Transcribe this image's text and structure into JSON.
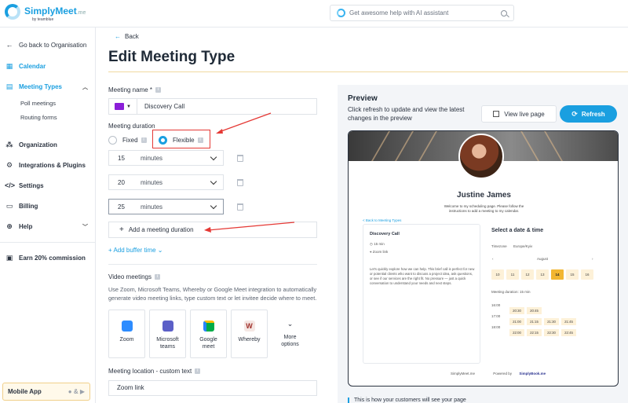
{
  "brand": {
    "name": "SimplyMeet",
    "suffix": ".me",
    "by": "by teamblue"
  },
  "search": {
    "placeholder": "Get awesome help with AI assistant"
  },
  "sidebar": {
    "back": "Go back to Organisation",
    "calendar": "Calendar",
    "meeting_types": "Meeting Types",
    "sub_items": [
      "Poll meetings",
      "Routing forms"
    ],
    "organization": "Organization",
    "integrations": "Integrations & Plugins",
    "settings": "Settings",
    "billing": "Billing",
    "help": "Help",
    "earn": "Earn 20% commission",
    "mobile_app": "Mobile App",
    "mobile_sep": "&"
  },
  "main": {
    "back": "Back",
    "title": "Edit Meeting Type",
    "meeting_name_label": "Meeting name *",
    "meeting_name_value": "Discovery Call",
    "meeting_color": "#8b1ed8",
    "duration_label": "Meeting duration",
    "option_fixed": "Fixed",
    "option_flexible": "Flexible",
    "selected_option": "Flexible",
    "durations": [
      {
        "value": "15",
        "unit": "minutes"
      },
      {
        "value": "20",
        "unit": "minutes"
      },
      {
        "value": "25",
        "unit": "minutes"
      }
    ],
    "add_duration": "Add a meeting duration",
    "add_buffer": "Add buffer time",
    "video_label": "Video meetings",
    "video_desc": "Use Zoom, Microsoft Teams, Whereby or Google Meet integration to automatically generate video meeting links, type custom text or let invitee decide where to meet.",
    "video_options": [
      {
        "label": "Zoom",
        "icon": "zoom-icon",
        "color": "#2d8cff"
      },
      {
        "label": "Microsoft teams",
        "icon": "teams-icon",
        "color": "#5b5fc7"
      },
      {
        "label": "Google meet",
        "icon": "google-meet-icon",
        "color": "#00ac47"
      },
      {
        "label": "Whereby",
        "icon": "whereby-icon",
        "color": "#f5e7e4"
      }
    ],
    "more_options": "More options",
    "location_label": "Meeting location - custom text",
    "location_value": "Zoom link"
  },
  "preview": {
    "title": "Preview",
    "desc": "Click refresh to update and view the latest changes in the preview",
    "view_live": "View live page",
    "refresh": "Refresh",
    "host_name": "Justine James",
    "welcome": "Welcome to my scheduling page. Please follow the instructions to add a meeting to my calendar.",
    "back_link": "< Back to Meeting Types",
    "call_name": "Discovery Call",
    "call_duration": "15 min",
    "call_location": "Zoom link",
    "call_body": "Let's quickly explore how we can help. This brief call is perfect for new or potential clients who want to discuss a project idea, ask questions, or see if our services are the right fit. No pressure — just a quick conversation to understand your needs and next steps.",
    "select_title": "Select a date & time",
    "timezone_label": "Timezone",
    "timezone_value": "Europe/Kyiv",
    "month": "August",
    "days": [
      "10",
      "11",
      "12",
      "13",
      "14",
      "15",
      "16"
    ],
    "selected_day": "14",
    "duration_text": "Meeting duration: 15 min",
    "time_rows": [
      {
        "label": "16:00",
        "slots": [
          "20:30",
          "20:45"
        ]
      },
      {
        "label": "17:00",
        "slots": [
          "21:00",
          "21:15",
          "21:30",
          "21:45"
        ]
      },
      {
        "label": "18:00",
        "slots": [
          "22:00",
          "22:15",
          "22:30",
          "22:45"
        ]
      }
    ],
    "footer_left": "SimplyMeet.me",
    "footer_mid": "Powered by",
    "footer_right": "SimplyBook.me",
    "caption": "This is how your customers will see your page"
  }
}
